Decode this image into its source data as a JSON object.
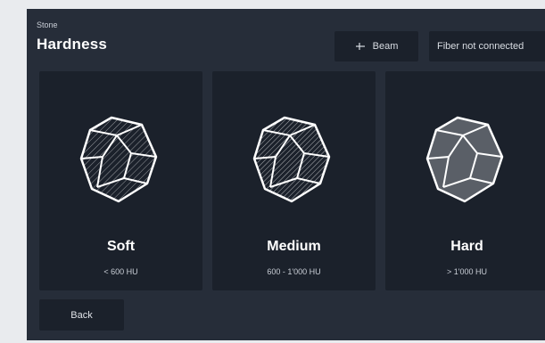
{
  "header": {
    "subtitle": "Stone",
    "title": "Hardness"
  },
  "toolbar": {
    "beam_label": "Beam",
    "beam_icon": "beam-icon",
    "fiber_status": "Fiber not connected"
  },
  "options": [
    {
      "label": "Soft",
      "range": "< 600 HU",
      "icon": "stone-soft-icon"
    },
    {
      "label": "Medium",
      "range": "600 - 1'000 HU",
      "icon": "stone-medium-icon"
    },
    {
      "label": "Hard",
      "range": "> 1'000 HU",
      "icon": "stone-hard-icon"
    }
  ],
  "footer": {
    "back_label": "Back"
  },
  "colors": {
    "background": "#262d39",
    "card": "#1b212b",
    "text": "#ffffff",
    "muted_text": "#c9ced6",
    "hard_stone_fill": "#5a5f67"
  }
}
